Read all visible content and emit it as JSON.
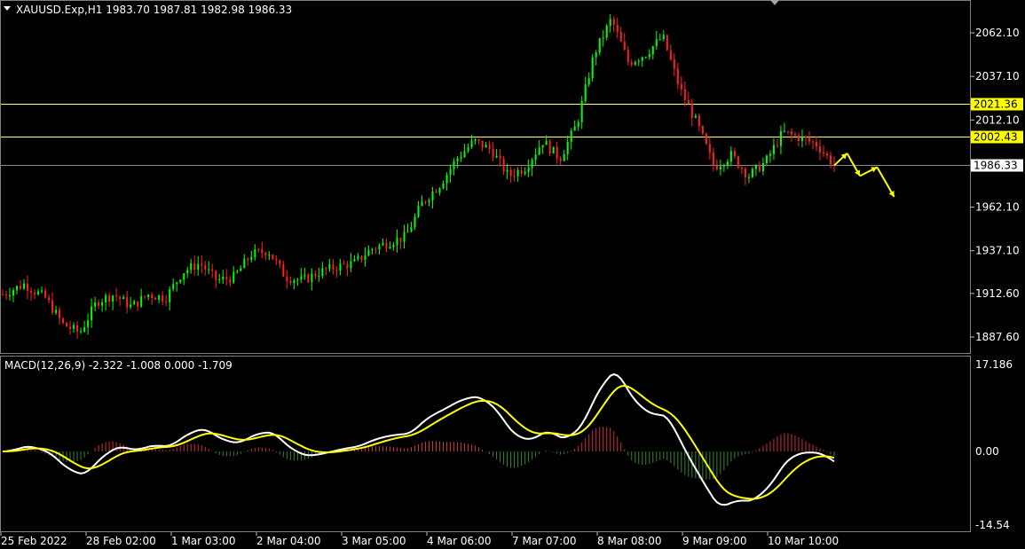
{
  "main_chart": {
    "header": "XAUUSD.Exp,H1  1983.70 1987.81 1982.98 1986.33",
    "price_labels": [
      "2062.10",
      "2037.10",
      "2012.10",
      "1962.10",
      "1937.10",
      "1912.60",
      "1887.60"
    ],
    "levels": [
      {
        "label": "2021.36",
        "value": 2021.36,
        "color": "#ffff66",
        "bg": "#ffff00",
        "fg": "#000000"
      },
      {
        "label": "2002.43",
        "value": 2002.43,
        "color": "#ffff66",
        "bg": "#ffff00",
        "fg": "#000000"
      },
      {
        "label": "1986.33",
        "value": 1986.33,
        "color": "#8c8c8c",
        "bg": "#ffffff",
        "fg": "#000000"
      }
    ],
    "bull_color": "#00ff00",
    "bear_color": "#ff2020",
    "arrow_color": "#ffff00"
  },
  "macd": {
    "header": "MACD(12,26,9) -2.322 -1.008 0.000 -1.709",
    "labels": [
      "17.186",
      "0.00",
      "-14.54"
    ],
    "main_line_color": "#ffffff",
    "signal_line_color": "#ffff00",
    "hist_up_color": "#cc3333",
    "hist_down_color": "#2e8b2e"
  },
  "time_labels": [
    "25 Feb 2022",
    "28 Feb 02:00",
    "1 Mar 03:00",
    "2 Mar 04:00",
    "3 Mar 05:00",
    "4 Mar 06:00",
    "7 Mar 07:00",
    "8 Mar 08:00",
    "9 Mar 09:00",
    "10 Mar 10:00"
  ],
  "chart_data": {
    "type": "candlestick",
    "symbol": "XAUUSD.Exp",
    "timeframe": "H1",
    "ylim": [
      1875,
      2075
    ],
    "close_path": [
      {
        "x": 0,
        "y": 1912
      },
      {
        "x": 5,
        "y": 1918
      },
      {
        "x": 10,
        "y": 1910
      },
      {
        "x": 14,
        "y": 1895
      },
      {
        "x": 18,
        "y": 1890
      },
      {
        "x": 22,
        "y": 1908
      },
      {
        "x": 26,
        "y": 1912
      },
      {
        "x": 30,
        "y": 1905
      },
      {
        "x": 34,
        "y": 1912
      },
      {
        "x": 38,
        "y": 1910
      },
      {
        "x": 42,
        "y": 1925
      },
      {
        "x": 46,
        "y": 1930
      },
      {
        "x": 50,
        "y": 1920
      },
      {
        "x": 54,
        "y": 1922
      },
      {
        "x": 58,
        "y": 1935
      },
      {
        "x": 62,
        "y": 1937
      },
      {
        "x": 66,
        "y": 1922
      },
      {
        "x": 70,
        "y": 1920
      },
      {
        "x": 74,
        "y": 1925
      },
      {
        "x": 78,
        "y": 1928
      },
      {
        "x": 82,
        "y": 1930
      },
      {
        "x": 86,
        "y": 1938
      },
      {
        "x": 90,
        "y": 1942
      },
      {
        "x": 94,
        "y": 1945
      },
      {
        "x": 98,
        "y": 1965
      },
      {
        "x": 102,
        "y": 1975
      },
      {
        "x": 106,
        "y": 1990
      },
      {
        "x": 110,
        "y": 2000
      },
      {
        "x": 114,
        "y": 1995
      },
      {
        "x": 118,
        "y": 1980
      },
      {
        "x": 122,
        "y": 1985
      },
      {
        "x": 126,
        "y": 2000
      },
      {
        "x": 130,
        "y": 1990
      },
      {
        "x": 134,
        "y": 2010
      },
      {
        "x": 138,
        "y": 2050
      },
      {
        "x": 142,
        "y": 2070
      },
      {
        "x": 146,
        "y": 2045
      },
      {
        "x": 150,
        "y": 2050
      },
      {
        "x": 154,
        "y": 2060
      },
      {
        "x": 158,
        "y": 2030
      },
      {
        "x": 162,
        "y": 2010
      },
      {
        "x": 166,
        "y": 1985
      },
      {
        "x": 170,
        "y": 1992
      },
      {
        "x": 174,
        "y": 1980
      },
      {
        "x": 178,
        "y": 1988
      },
      {
        "x": 182,
        "y": 2005
      },
      {
        "x": 186,
        "y": 2002
      },
      {
        "x": 190,
        "y": 1998
      },
      {
        "x": 194,
        "y": 1986
      }
    ],
    "projection": [
      {
        "x": 194,
        "y": 1986
      },
      {
        "x": 197,
        "y": 1993
      },
      {
        "x": 200,
        "y": 1980
      },
      {
        "x": 204,
        "y": 1985
      },
      {
        "x": 208,
        "y": 1968
      }
    ]
  }
}
